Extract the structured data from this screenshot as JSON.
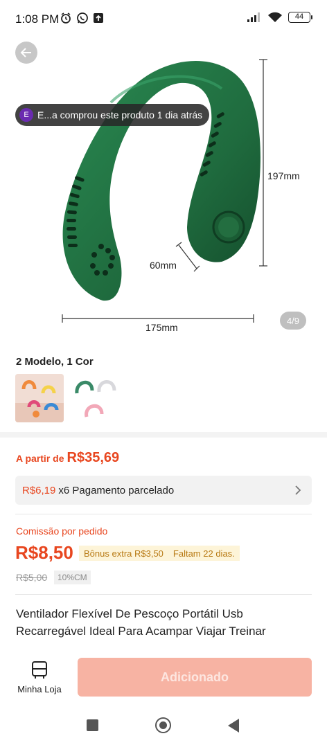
{
  "status_bar": {
    "time": "1:08 PM",
    "battery": "44"
  },
  "product_image": {
    "toast_avatar": "E",
    "toast_text": "E...a comprou este produto 1 dia atrás",
    "dim_height": "197mm",
    "dim_depth": "60mm",
    "dim_width": "175mm",
    "page_counter": "4/9",
    "product_color": "#1f6b3e"
  },
  "variants": {
    "title": "2 Modelo, 1 Cor"
  },
  "price": {
    "prefix": "A partir de",
    "value": "R$35,69"
  },
  "installment": {
    "value": "R$6,19",
    "text": "x6 Pagamento parcelado"
  },
  "commission": {
    "label": "Comissão por pedido",
    "value": "R$8,50",
    "bonus": "Bônus extra R$3,50",
    "days_left": "Faltam 22 dias.",
    "old_value": "R$5,00",
    "rate_badge": "10%CM"
  },
  "product_title": "Ventilador Flexível De Pescoço Portátil Usb Recarregável Ideal Para Acampar Viajar Treinar",
  "action_bar": {
    "store_label": "Minha Loja",
    "add_button": "Adicionado"
  },
  "colors": {
    "accent": "#e8461f",
    "button_disabled": "#f7b3a3",
    "bonus_bg": "#fdf4d8"
  },
  "icons": [
    "signal-icon",
    "wifi-icon",
    "alarm-icon",
    "whatsapp-icon",
    "upload-icon",
    "back-arrow-icon",
    "chevron-right-icon",
    "store-icon"
  ]
}
